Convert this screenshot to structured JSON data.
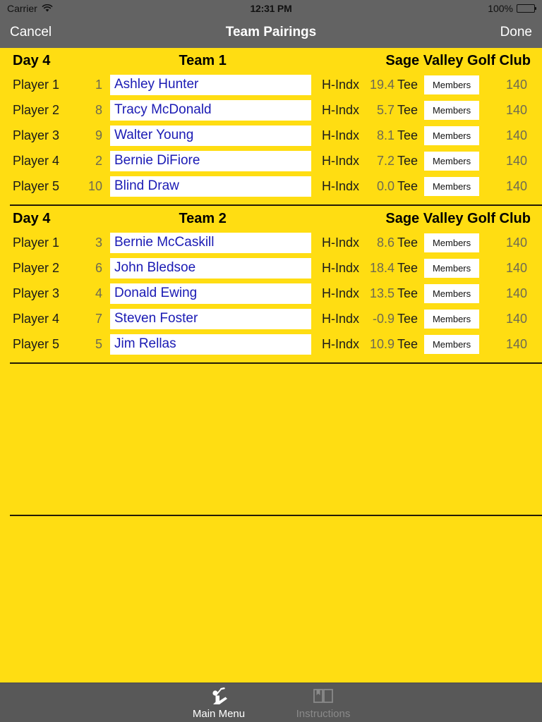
{
  "status_bar": {
    "carrier": "Carrier",
    "wifi_icon": "wifi-icon",
    "time": "12:31 PM",
    "battery_percent": "100%",
    "battery_icon": "battery-icon"
  },
  "nav_bar": {
    "cancel_label": "Cancel",
    "title": "Team Pairings",
    "done_label": "Done"
  },
  "colors": {
    "background_yellow": "#FFDD12",
    "nav_grey": "#636363",
    "tab_grey": "#585858",
    "name_text_blue": "#1a1ab4",
    "muted_value": "#6e6a53",
    "divider": "#231a05"
  },
  "sections": [
    {
      "day": "Day 4",
      "team": "Team 1",
      "course": "Sage Valley Golf Club",
      "players": [
        {
          "label": "Player 1",
          "seed": "1",
          "name": "Ashley Hunter",
          "handicap_label": "H-Indx",
          "handicap": "19.4",
          "tee_label": "Tee",
          "tee_button": "Members",
          "yardage": "140"
        },
        {
          "label": "Player 2",
          "seed": "8",
          "name": "Tracy McDonald",
          "handicap_label": "H-Indx",
          "handicap": "5.7",
          "tee_label": "Tee",
          "tee_button": "Members",
          "yardage": "140"
        },
        {
          "label": "Player 3",
          "seed": "9",
          "name": "Walter Young",
          "handicap_label": "H-Indx",
          "handicap": "8.1",
          "tee_label": "Tee",
          "tee_button": "Members",
          "yardage": "140"
        },
        {
          "label": "Player 4",
          "seed": "2",
          "name": "Bernie DiFiore",
          "handicap_label": "H-Indx",
          "handicap": "7.2",
          "tee_label": "Tee",
          "tee_button": "Members",
          "yardage": "140"
        },
        {
          "label": "Player 5",
          "seed": "10",
          "name": "Blind Draw",
          "handicap_label": "H-Indx",
          "handicap": "0.0",
          "tee_label": "Tee",
          "tee_button": "Members",
          "yardage": "140"
        }
      ]
    },
    {
      "day": "Day 4",
      "team": "Team 2",
      "course": "Sage Valley Golf Club",
      "players": [
        {
          "label": "Player 1",
          "seed": "3",
          "name": "Bernie McCaskill",
          "handicap_label": "H-Indx",
          "handicap": "8.6",
          "tee_label": "Tee",
          "tee_button": "Members",
          "yardage": "140"
        },
        {
          "label": "Player 2",
          "seed": "6",
          "name": "John Bledsoe",
          "handicap_label": "H-Indx",
          "handicap": "18.4",
          "tee_label": "Tee",
          "tee_button": "Members",
          "yardage": "140"
        },
        {
          "label": "Player 3",
          "seed": "4",
          "name": "Donald Ewing",
          "handicap_label": "H-Indx",
          "handicap": "13.5",
          "tee_label": "Tee",
          "tee_button": "Members",
          "yardage": "140"
        },
        {
          "label": "Player 4",
          "seed": "7",
          "name": "Steven Foster",
          "handicap_label": "H-Indx",
          "handicap": "-0.9",
          "tee_label": "Tee",
          "tee_button": "Members",
          "yardage": "140"
        },
        {
          "label": "Player 5",
          "seed": "5",
          "name": "Jim Rellas",
          "handicap_label": "H-Indx",
          "handicap": "10.9",
          "tee_label": "Tee",
          "tee_button": "Members",
          "yardage": "140"
        }
      ]
    }
  ],
  "tab_bar": {
    "items": [
      {
        "label": "Main Menu",
        "icon": "golfer-icon",
        "active": true
      },
      {
        "label": "Instructions",
        "icon": "open-book-icon",
        "active": false
      }
    ]
  }
}
